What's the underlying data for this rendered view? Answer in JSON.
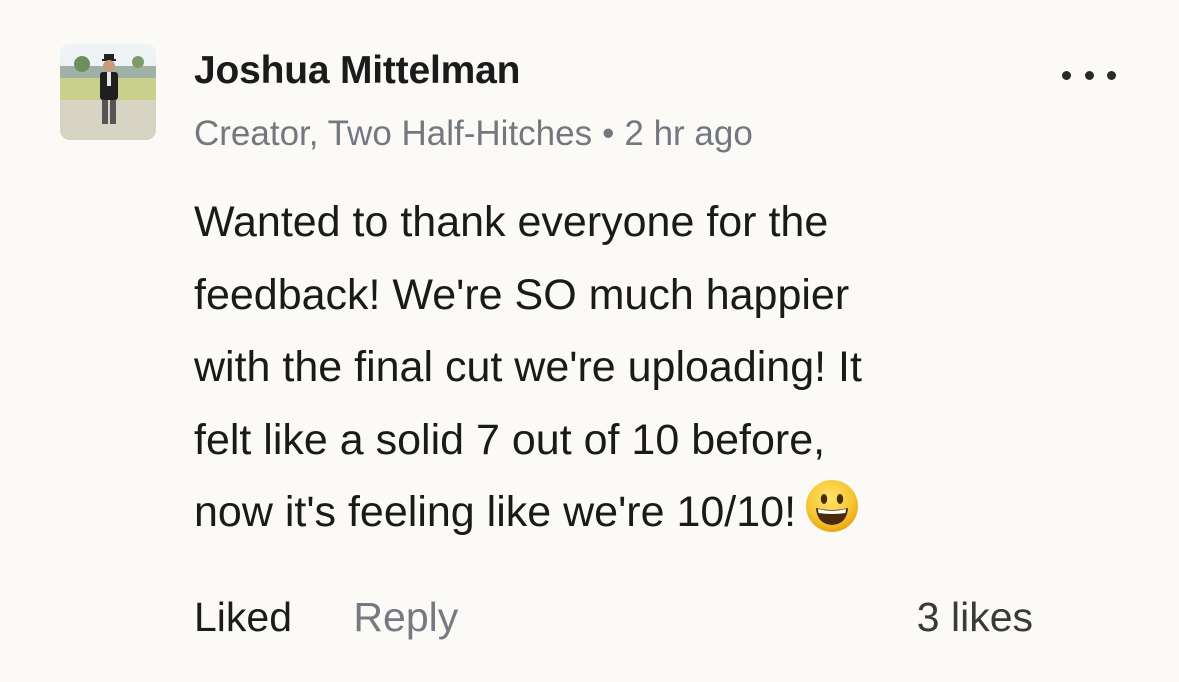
{
  "comment": {
    "author": "Joshua Mittelman",
    "role": "Creator, Two Half-Hitches",
    "separator": "•",
    "time": "2 hr ago",
    "body_lines": [
      "Wanted to thank everyone for the",
      "feedback! We're SO much happier",
      "with the final cut we're uploading! It",
      "felt like a solid 7 out of 10 before,",
      "now it's feeling like we're 10/10!"
    ],
    "emoji": "grinning-face-emoji",
    "more_icon": "more-horizontal-icon"
  },
  "actions": {
    "liked_label": "Liked",
    "reply_label": "Reply",
    "likes_count": "3 likes"
  },
  "colors": {
    "background": "#fbfaf6",
    "text_primary": "#1b1b1b",
    "text_secondary": "#737880"
  }
}
